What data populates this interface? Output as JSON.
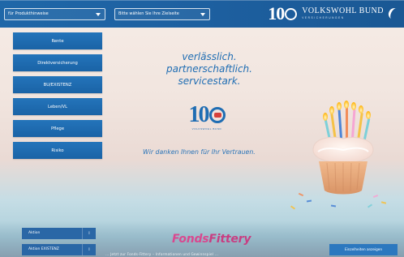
{
  "topbar": {
    "select_1": {
      "value": "für Produkthinweise"
    },
    "select_2": {
      "value": "Bitte wählen Sie Ihre Zielseite"
    },
    "brand_logo": {
      "number": "10",
      "name": "VOLKSWOHL BUND",
      "tag": "VERSICHERUNGEN"
    }
  },
  "sidebar": {
    "items": [
      {
        "label": "Rente"
      },
      {
        "label": "Direktversicherung"
      },
      {
        "label": "BU/EXISTENZ"
      },
      {
        "label": "Leben/VL"
      },
      {
        "label": "Pflege"
      },
      {
        "label": "Risiko"
      }
    ]
  },
  "main": {
    "headline": [
      "verlässlich.",
      "partnerschaftlich.",
      "servicestark."
    ],
    "center_logo": {
      "number": "10",
      "subtext": "VOLKSWOHL BUND"
    },
    "thanks": "Wir danken Ihnen für Ihr Vertrauen."
  },
  "bottom": {
    "mini_buttons": [
      {
        "label": "Aktion",
        "suffix": "i"
      },
      {
        "label": "Aktion EXISTENZ",
        "suffix": "i"
      }
    ],
    "fonds_brand": {
      "part1": "Fonds",
      "part2": "Fittery"
    },
    "caption": "... Jetzt zur Fonds-Fittery – Informationen und Gewinnspiel ...",
    "cta": "Einzelheiten anzeigen"
  },
  "colors": {
    "primary_blue": "#1f6db3",
    "nav_blue": "#1a63a6",
    "fonds_pink": "#d9488f",
    "background": "#f1e5df"
  }
}
